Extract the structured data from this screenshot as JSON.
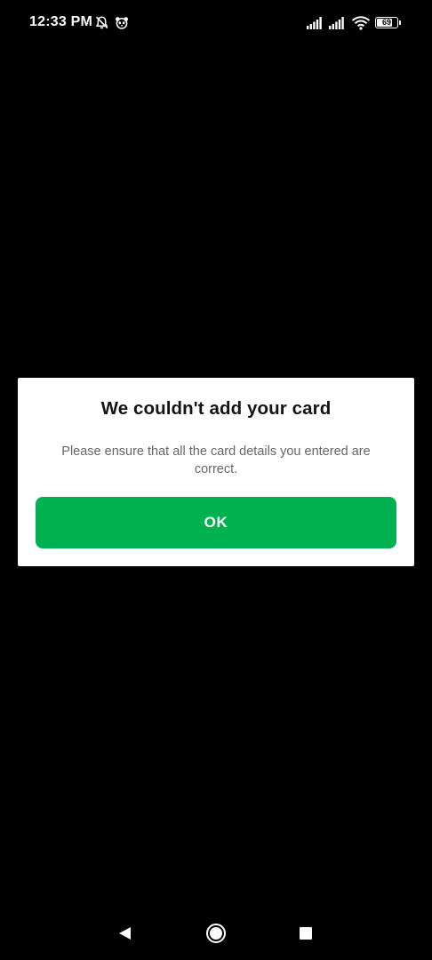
{
  "status_bar": {
    "time": "12:33 PM",
    "battery_level": "69",
    "icons": [
      "bell-off-icon",
      "panda-app-icon",
      "signal-icon",
      "signal-icon",
      "wifi-icon",
      "battery-icon"
    ]
  },
  "dialog": {
    "title": "We couldn't add your card",
    "message": "Please ensure that all the card details you entered are correct.",
    "ok_label": "OK"
  },
  "nav_bar": {
    "icons": [
      "back-icon",
      "home-icon",
      "recents-icon"
    ]
  },
  "colors": {
    "background": "#000000",
    "dialog_background": "#ffffff",
    "primary_button": "#00b14f",
    "title_text": "#141414",
    "message_text": "#666666"
  }
}
